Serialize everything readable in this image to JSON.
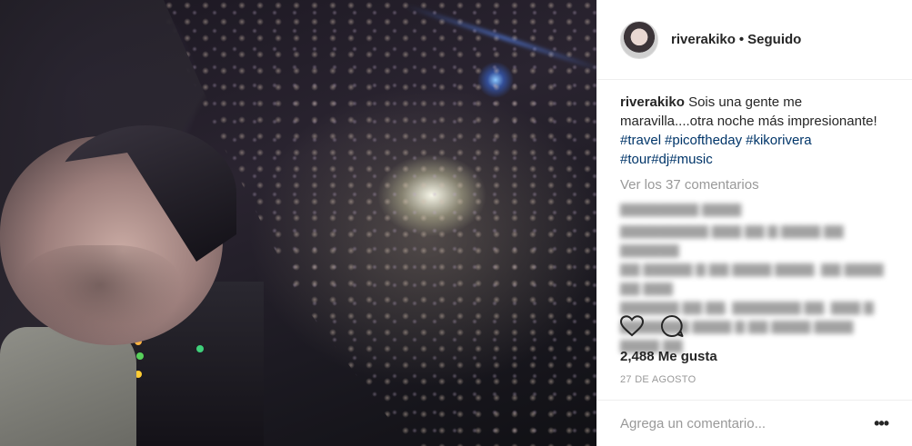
{
  "post": {
    "username": "riverakiko",
    "separator": "•",
    "follow_status": "Seguido",
    "caption_user": "riverakiko",
    "caption_text": "Sois una gente me maravilla....otra noche más impresionante!",
    "hashtags_line1": [
      "#travel",
      "#picoftheday",
      "#kikorivera"
    ],
    "hashtags_line2": [
      "#tour",
      "#dj",
      "#music"
    ],
    "view_comments": "Ver los 37 comentarios",
    "likes": "2,488 Me gusta",
    "date": "27 DE AGOSTO",
    "comment_placeholder": "Agrega un comentario...",
    "more_label": "•••"
  },
  "icons": {
    "like": "heart-icon",
    "comment": "comment-bubble-icon",
    "options": "more-options-icon"
  },
  "colors": {
    "text": "#262626",
    "muted": "#999999",
    "hashtag": "#003569",
    "border": "#efefef"
  }
}
